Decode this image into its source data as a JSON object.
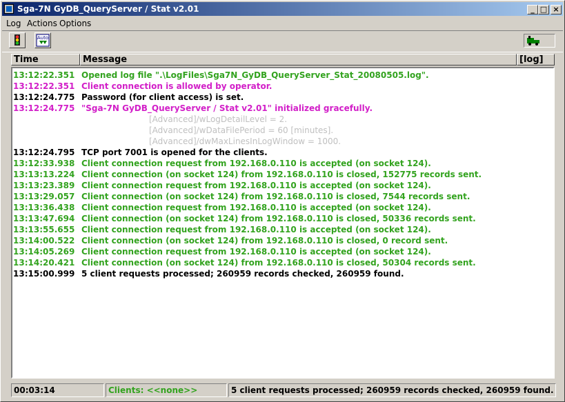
{
  "window": {
    "title": "Sga-7N GyDB_QueryServer / Stat  v2.01"
  },
  "title_buttons": {
    "minimize": "_",
    "maximize": "□",
    "close": "×"
  },
  "menu": [
    "Log",
    "Actions",
    "Options"
  ],
  "toolbar": {
    "buttons": [
      "traffic-light-icon",
      "auto-download-icon"
    ],
    "auto_label": "Auto",
    "indicator": "engine-icon"
  },
  "columns": {
    "time": "Time",
    "message": "Message",
    "log": "[log]"
  },
  "colors": {
    "green": "#33a31f",
    "magenta": "#d21fc8",
    "black": "#000000",
    "gray": "#c0c0c0"
  },
  "log": [
    {
      "time": "13:12:22.351",
      "message": "Opened log file \".\\LogFiles\\Sga7N_GyDB_QueryServer_Stat_20080505.log\".",
      "color": "green"
    },
    {
      "time": "13:12:22.351",
      "message": "Client connection is allowed by operator.",
      "color": "magenta"
    },
    {
      "time": "13:12:24.775",
      "message": "Password (for client access) is set.",
      "color": "black"
    },
    {
      "time": "13:12:24.775",
      "message": "\"Sga-7N GyDB_QueryServer / Stat  v2.01\" initialized gracefully.",
      "color": "magenta"
    },
    {
      "time": "",
      "message": "[Advanced]/wLogDetailLevel = 2.",
      "color": "gray",
      "sub": true
    },
    {
      "time": "",
      "message": "[Advanced]/wDataFilePeriod = 60 [minutes].",
      "color": "gray",
      "sub": true
    },
    {
      "time": "",
      "message": "[Advanced]/dwMaxLinesInLogWindow = 1000.",
      "color": "gray",
      "sub": true
    },
    {
      "time": "13:12:24.795",
      "message": "TCP port 7001 is opened for the clients.",
      "color": "black"
    },
    {
      "time": "13:12:33.938",
      "message": "Client connection request from 192.168.0.110 is accepted (on socket 124).",
      "color": "green"
    },
    {
      "time": "13:13:13.224",
      "message": "Client connection (on socket 124) from 192.168.0.110 is closed, 152775 records sent.",
      "color": "green"
    },
    {
      "time": "13:13:23.389",
      "message": "Client connection request from 192.168.0.110 is accepted (on socket 124).",
      "color": "green"
    },
    {
      "time": "13:13:29.057",
      "message": "Client connection (on socket 124) from 192.168.0.110 is closed, 7544 records sent.",
      "color": "green"
    },
    {
      "time": "13:13:36.438",
      "message": "Client connection request from 192.168.0.110 is accepted (on socket 124).",
      "color": "green"
    },
    {
      "time": "13:13:47.694",
      "message": "Client connection (on socket 124) from 192.168.0.110 is closed, 50336 records sent.",
      "color": "green"
    },
    {
      "time": "13:13:55.655",
      "message": "Client connection request from 192.168.0.110 is accepted (on socket 124).",
      "color": "green"
    },
    {
      "time": "13:14:00.522",
      "message": "Client connection (on socket 124) from 192.168.0.110 is closed, 0 record sent.",
      "color": "green"
    },
    {
      "time": "13:14:05.269",
      "message": "Client connection request from 192.168.0.110 is accepted (on socket 124).",
      "color": "green"
    },
    {
      "time": "13:14:20.421",
      "message": "Client connection (on socket 124) from 192.168.0.110 is closed, 50304 records sent.",
      "color": "green"
    },
    {
      "time": "13:15:00.999",
      "message": "5 client requests processed; 260959 records checked, 260959 found.",
      "color": "black"
    }
  ],
  "status": {
    "elapsed": "00:03:14",
    "clients": "Clients: <<none>>",
    "summary": "5 client requests processed;  260959 records checked, 260959 found."
  }
}
